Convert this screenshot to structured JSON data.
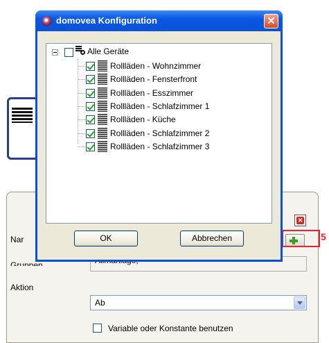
{
  "dialog": {
    "title": "domovea Konfiguration",
    "close_glyph": "✕",
    "tree": {
      "root_label": "Alle Geräte",
      "items": [
        {
          "label": "Rollläden - Wohnzimmer",
          "checked": true
        },
        {
          "label": "Rollläden - Fensterfront",
          "checked": true
        },
        {
          "label": "Rollläden - Esszimmer",
          "checked": true
        },
        {
          "label": "Rollläden - Schlafzimmer 1",
          "checked": true
        },
        {
          "label": "Rollläden - Küche",
          "checked": true
        },
        {
          "label": "Rollläden - Schlafzimmer 2",
          "checked": true
        },
        {
          "label": "Rollläden - Schlafzimmer 3",
          "checked": true
        }
      ]
    },
    "ok_label": "OK",
    "cancel_label": "Abbrechen"
  },
  "background_form": {
    "name_label_partial": "Nar",
    "group_label_partial": "Gruppen",
    "group_value_partial": "Allmanlage,",
    "action_label": "Aktion",
    "action_value": "Ab",
    "variable_checkbox_label": "Variable oder Konstante benutzen",
    "variable_checked": false,
    "step_number": "5"
  },
  "icons": {
    "window": "domovea-globe-icon",
    "root": "blinds-key-icon",
    "items": "roller-shutter-icon",
    "add": "green-plus-icon",
    "remove": "red-x-icon"
  },
  "colors": {
    "titlebar": "#0a51d8",
    "dialog_bg": "#ece9d8",
    "highlight": "#e8232a"
  }
}
